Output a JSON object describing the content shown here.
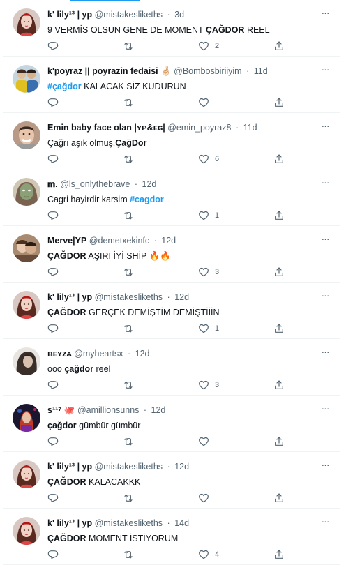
{
  "tweets": [
    {
      "name": "k' lily¹³ | yp",
      "handle": "@mistakesliketh s",
      "time": "3d",
      "likes": "2",
      "avatar": "lily",
      "segments": [
        {
          "t": "9 VERMİS OLSUN GENE DE MOMENT "
        },
        {
          "t": "ÇAĞDOR",
          "s": "b"
        },
        {
          "t": " REEL"
        }
      ]
    },
    {
      "name": "k'poyraz || poyrazin fedaisi 🤞🏻",
      "handle": "@Bombosbiriiyim",
      "time": "11d",
      "likes": "",
      "avatar": "group",
      "segments": [
        {
          "t": "#çağdor",
          "s": "tag"
        },
        {
          "t": " KALACAK SİZ KUDURUN"
        }
      ]
    },
    {
      "name": "Emin baby face olan |ʏᴘ&ᴇɢ|",
      "handle": "@emin_poyraz8",
      "time": "11d",
      "likes": "6",
      "avatar": "man",
      "segments": [
        {
          "t": "Çağrı aşık olmuş."
        },
        {
          "t": "ÇağDor",
          "s": "b"
        }
      ]
    },
    {
      "name": "𝐦.",
      "handle": "@ls_onlythebrave",
      "time": "12d",
      "likes": "1",
      "avatar": "mask",
      "segments": [
        {
          "t": "Cagri hayirdir karsim "
        },
        {
          "t": "#cagdor",
          "s": "tag"
        }
      ]
    },
    {
      "name": "Merve|YP",
      "handle": "@demetxekinfc",
      "time": "12d",
      "likes": "3",
      "avatar": "couple",
      "segments": [
        {
          "t": "ÇAĞDOR",
          "s": "b"
        },
        {
          "t": " AŞIRI İYİ SHİP 🔥🔥"
        }
      ]
    },
    {
      "name": "k' lily¹³ | yp",
      "handle": "@mistakesliketh s",
      "time": "12d",
      "likes": "1",
      "avatar": "lily",
      "segments": [
        {
          "t": "ÇAĞDOR",
          "s": "b"
        },
        {
          "t": " GERÇEK DEMİŞTİM DEMİŞTİİİN"
        }
      ]
    },
    {
      "name": "ʙᴇʏᴢᴀ",
      "handle": "@myheartsx",
      "time": "12d",
      "likes": "3",
      "avatar": "beyza",
      "segments": [
        {
          "t": "ooo "
        },
        {
          "t": "çağdor",
          "s": "b"
        },
        {
          "t": " reel"
        }
      ]
    },
    {
      "name": "s¹¹⁷ 🐙",
      "handle": "@amillionsunns",
      "time": "12d",
      "likes": "",
      "avatar": "singer",
      "segments": [
        {
          "t": "çağdor",
          "s": "b"
        },
        {
          "t": " gümbür gümbür"
        }
      ]
    },
    {
      "name": "k' lily¹³ | yp",
      "handle": "@mistakesliketh s",
      "time": "12d",
      "likes": "",
      "avatar": "lily",
      "segments": [
        {
          "t": "ÇAĞDOR",
          "s": "b"
        },
        {
          "t": " KALACAKKK"
        }
      ]
    },
    {
      "name": "k' lily¹³ | yp",
      "handle": "@mistakesliketh s",
      "time": "14d",
      "likes": "4",
      "avatar": "lily",
      "segments": [
        {
          "t": "ÇAĞDOR",
          "s": "b"
        },
        {
          "t": " MOMENT İSTİYORUM"
        }
      ]
    }
  ],
  "colors": {
    "accent": "#1d9bf0",
    "muted": "#536471",
    "divider": "#eff3f4"
  },
  "icons": {
    "reply": "reply-icon",
    "retweet": "retweet-icon",
    "like": "heart-icon",
    "share": "share-icon",
    "more": "more-dots-icon"
  }
}
